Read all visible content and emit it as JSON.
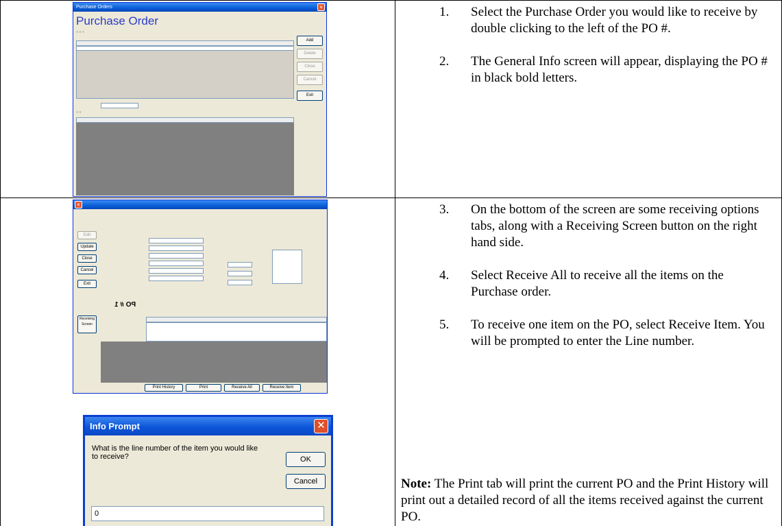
{
  "steps_row1": [
    {
      "num": "1.",
      "text": "Select the Purchase Order you would like to receive by double clicking to the left of the PO #."
    },
    {
      "num": "2.",
      "text": "The General Info screen will appear, displaying the PO # in black bold letters."
    }
  ],
  "steps_row2": [
    {
      "num": "3.",
      "text": "On the bottom of the screen are some receiving options tabs, along with a Receiving Screen button on the right hand side."
    },
    {
      "num": "4.",
      "text": "Select Receive All to receive all the items on the Purchase order."
    },
    {
      "num": "5.",
      "text": "To receive one item on the PO, select Receive Item.  You will be prompted to enter the Line number."
    }
  ],
  "note": {
    "label": "Note:",
    "text": " The Print tab will print the current PO and the Print History will print out a detailed record of all the items received against the current PO."
  },
  "purchase_order_window": {
    "window_title": "Purchase Orders",
    "heading": "Purchase Order",
    "buttons": [
      "Add",
      "Delete",
      "Close",
      "Cancel",
      "Exit"
    ]
  },
  "po_detail_window": {
    "po_label": "PO # 1",
    "buttons_left": [
      "Edit",
      "Update",
      "Close",
      "Cancel",
      "Exit"
    ],
    "bottom_tabs": [
      "Receive Item",
      "Receive All",
      "Print",
      "Print History"
    ],
    "receiving_button": "Receiving Screen"
  },
  "info_prompt": {
    "title": "Info Prompt",
    "message": "What is the line number of the item you would like to receive?",
    "ok_label": "OK",
    "cancel_label": "Cancel",
    "input_value": "0"
  },
  "colors": {
    "xp_title_blue": "#0a5ed7",
    "window_face": "#ece9d8",
    "close_red": "#e0502a"
  }
}
